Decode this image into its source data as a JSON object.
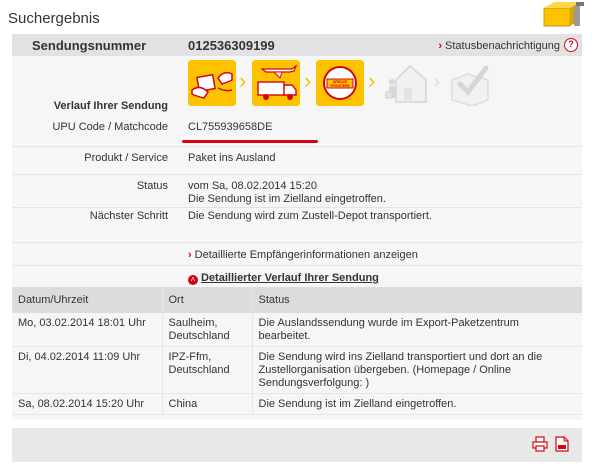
{
  "page": {
    "title": "Suchergebnis"
  },
  "header": {
    "label": "Sendungsnummer",
    "number": "012536309199",
    "notify_label": "Statusbenachrichtigung",
    "help": "?"
  },
  "progress": {
    "label": "Verlauf Ihrer Sendung",
    "total_steps": 5,
    "completed_steps": 3,
    "border_sign": "GRENZE FRONTIERE"
  },
  "details": [
    {
      "label": "UPU Code / Matchcode",
      "value": "CL755939658DE"
    },
    {
      "label": "Produkt / Service",
      "value": "Paket ins Ausland"
    },
    {
      "label": "Status",
      "value": "vom Sa, 08.02.2014 15:20",
      "value2": "Die Sendung ist im Zielland eingetroffen."
    },
    {
      "label": "Nächster Schritt",
      "value": "Die Sendung wird zum Zustell-Depot transportiert."
    }
  ],
  "links": {
    "recipient": "Detaillierte Empfängerinformationen anzeigen",
    "history": "Detaillierter Verlauf Ihrer Sendung"
  },
  "history_table": {
    "headers": [
      "Datum/Uhrzeit",
      "Ort",
      "Status"
    ],
    "rows": [
      {
        "date": "Mo, 03.02.2014 18:01 Uhr",
        "place1": "Saulheim,",
        "place2": "Deutschland",
        "status1": "Die Auslandssendung wurde im Export-Paketzentrum",
        "status2": "bearbeitet.",
        "status3": ""
      },
      {
        "date": "Di, 04.02.2014 11:09 Uhr",
        "place1": "IPZ-Ffm,",
        "place2": "Deutschland",
        "status1": "Die Sendung wird ins Zielland transportiert und dort an die",
        "status2": "Zustellorganisation übergeben. (Homepage / Online",
        "status3": "Sendungsverfolgung: )"
      },
      {
        "date": "Sa, 08.02.2014 15:20 Uhr",
        "place1": "China",
        "place2": "",
        "status1": "Die Sendung ist im Zielland eingetroffen.",
        "status2": "",
        "status3": ""
      }
    ]
  },
  "icons": {
    "notify": "chevron-right-icon",
    "print": "print-icon",
    "pdf": "pdf-icon",
    "logo": "dhl-parcel-logo"
  },
  "colors": {
    "accent": "#d40511",
    "yellow": "#fdc300",
    "grey_step": "#e0e0e0"
  }
}
